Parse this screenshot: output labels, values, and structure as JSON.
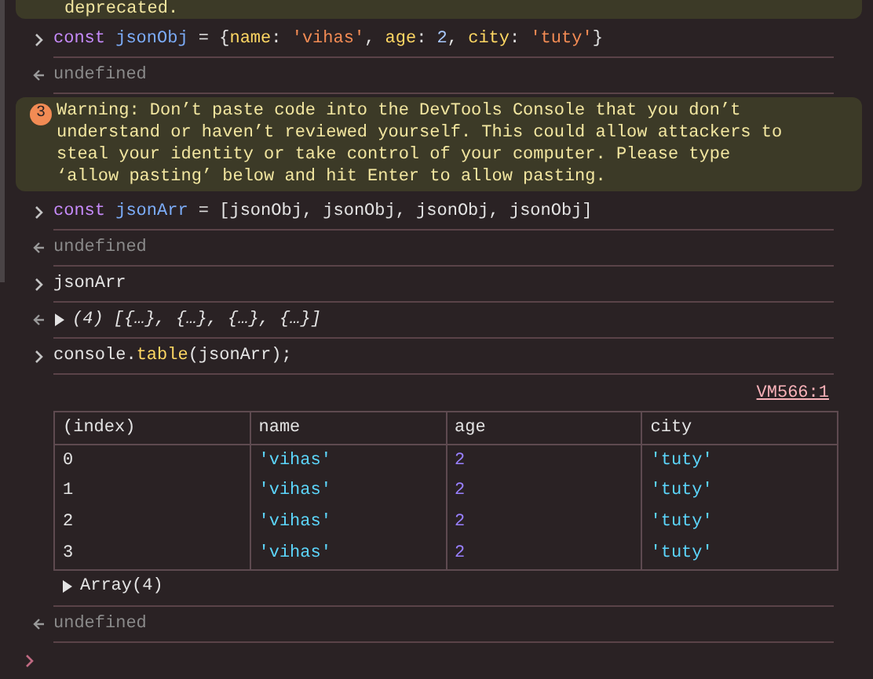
{
  "console": {
    "entries": [
      {
        "kind": "warning_tail",
        "text": "deprecated."
      },
      {
        "kind": "input",
        "tokens": [
          {
            "kind": "keyword",
            "text": "const "
          },
          {
            "kind": "variable",
            "text": "jsonObj"
          },
          {
            "kind": "plain",
            "text": " = {"
          },
          {
            "kind": "property",
            "text": "name"
          },
          {
            "kind": "plain",
            "text": ": "
          },
          {
            "kind": "string",
            "text": "'vihas'"
          },
          {
            "kind": "plain",
            "text": ", "
          },
          {
            "kind": "property",
            "text": "age"
          },
          {
            "kind": "plain",
            "text": ": "
          },
          {
            "kind": "number",
            "text": "2"
          },
          {
            "kind": "plain",
            "text": ", "
          },
          {
            "kind": "property",
            "text": "city"
          },
          {
            "kind": "plain",
            "text": ": "
          },
          {
            "kind": "string",
            "text": "'tuty'"
          },
          {
            "kind": "plain",
            "text": "}"
          }
        ]
      },
      {
        "kind": "result",
        "text": "undefined"
      },
      {
        "kind": "warning",
        "count": "3",
        "text": "Warning: Don’t paste code into the DevTools Console that you don’t understand or haven’t reviewed yourself. This could allow attackers to steal your identity or take control of your computer. Please type ‘allow pasting’ below and hit Enter to allow pasting."
      },
      {
        "kind": "input",
        "tokens": [
          {
            "kind": "keyword",
            "text": "const "
          },
          {
            "kind": "variable",
            "text": "jsonArr"
          },
          {
            "kind": "plain",
            "text": " = [jsonObj, jsonObj, jsonObj, jsonObj]"
          }
        ]
      },
      {
        "kind": "result",
        "text": "undefined"
      },
      {
        "kind": "input",
        "tokens": [
          {
            "kind": "plain",
            "text": "jsonArr"
          }
        ]
      },
      {
        "kind": "object",
        "text": "(4) [{…}, {…}, {…}, {…}]",
        "expanded": false
      },
      {
        "kind": "input",
        "tokens": [
          {
            "kind": "plain",
            "text": "console."
          },
          {
            "kind": "property",
            "text": "table"
          },
          {
            "kind": "plain",
            "text": "(jsonArr);"
          }
        ]
      },
      {
        "kind": "table",
        "source": "VM566:1",
        "columns": [
          "(index)",
          "name",
          "age",
          "city"
        ],
        "rows": [
          [
            {
              "kind": "plain",
              "text": "0"
            },
            {
              "kind": "tstring",
              "text": "'vihas'"
            },
            {
              "kind": "tnumber",
              "text": "2"
            },
            {
              "kind": "tstring",
              "text": "'tuty'"
            }
          ],
          [
            {
              "kind": "plain",
              "text": "1"
            },
            {
              "kind": "tstring",
              "text": "'vihas'"
            },
            {
              "kind": "tnumber",
              "text": "2"
            },
            {
              "kind": "tstring",
              "text": "'tuty'"
            }
          ],
          [
            {
              "kind": "plain",
              "text": "2"
            },
            {
              "kind": "tstring",
              "text": "'vihas'"
            },
            {
              "kind": "tnumber",
              "text": "2"
            },
            {
              "kind": "tstring",
              "text": "'tuty'"
            }
          ],
          [
            {
              "kind": "plain",
              "text": "3"
            },
            {
              "kind": "tstring",
              "text": "'vihas'"
            },
            {
              "kind": "tnumber",
              "text": "2"
            },
            {
              "kind": "tstring",
              "text": "'tuty'"
            }
          ]
        ],
        "footer": {
          "text": "Array(4)",
          "expanded": false
        }
      },
      {
        "kind": "result",
        "text": "undefined"
      }
    ]
  }
}
